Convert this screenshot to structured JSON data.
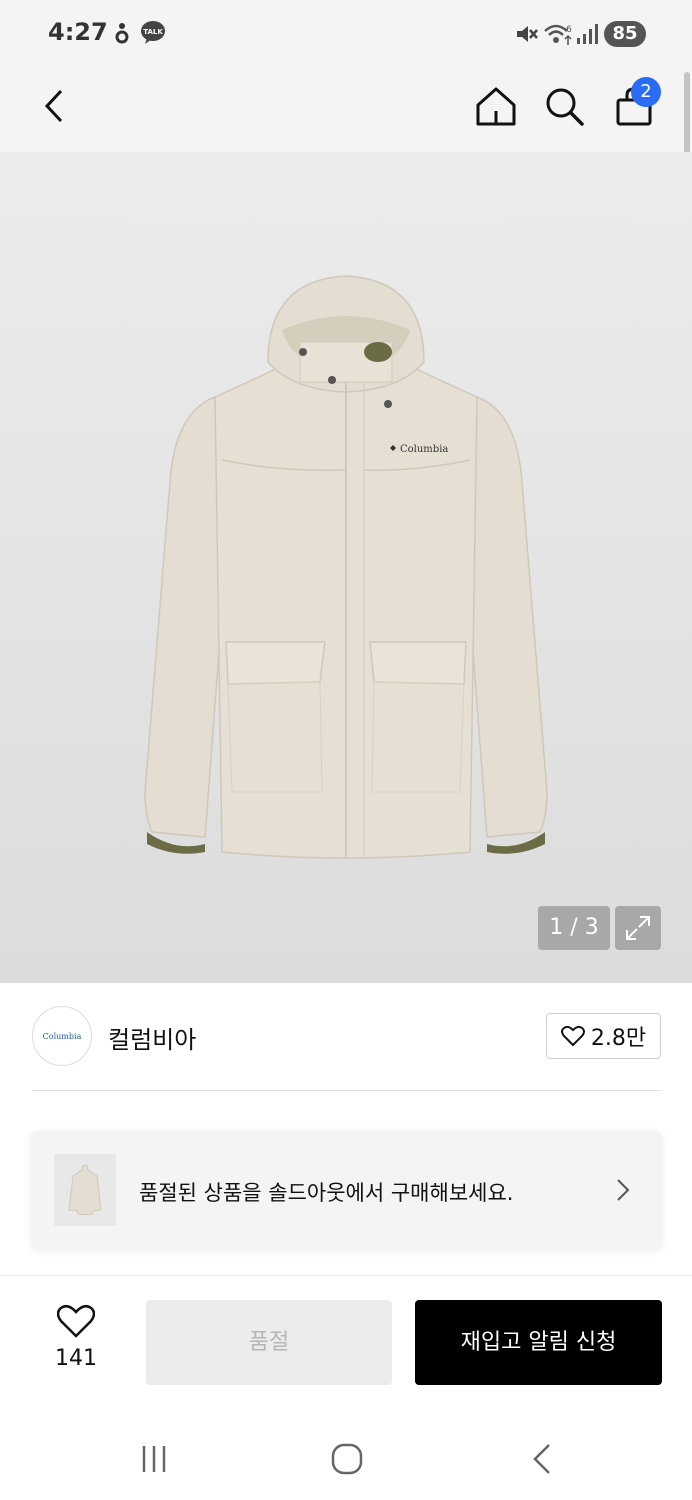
{
  "status_bar": {
    "time": "4:27",
    "battery": "85",
    "icons": [
      "notification-icon",
      "kakaotalk-icon",
      "mute-icon",
      "wifi-icon",
      "signal-icon",
      "battery-icon"
    ]
  },
  "app_bar": {
    "icons": [
      "back-icon",
      "home-icon",
      "search-icon",
      "shopping-bag-icon"
    ],
    "cart_count": "2"
  },
  "product_image": {
    "counter": "1 / 3",
    "print": "Columbia",
    "icons": [
      "expand-icon"
    ]
  },
  "brand": {
    "logo_text": "Columbia",
    "name": "컬럼비아",
    "likes": "2.8만",
    "icons": [
      "heart-icon"
    ]
  },
  "soldout_banner": {
    "text": "품절된 상품을 솔드아웃에서 구매해보세요.",
    "icons": [
      "chevron-right-icon"
    ]
  },
  "bottom_bar": {
    "wish_count": "141",
    "soldout_label": "품절",
    "restock_label": "재입고 알림 신청",
    "icons": [
      "heart-icon"
    ]
  },
  "nav_bar": {
    "icons": [
      "recent-apps-icon",
      "home-circle-icon",
      "back-icon"
    ]
  },
  "colors": {
    "cart_badge": "#2b6cf6",
    "restock_button": "#000000",
    "soldout_button": "#ececec",
    "jacket": "#e4ded2",
    "cuff": "#6b6b45"
  }
}
